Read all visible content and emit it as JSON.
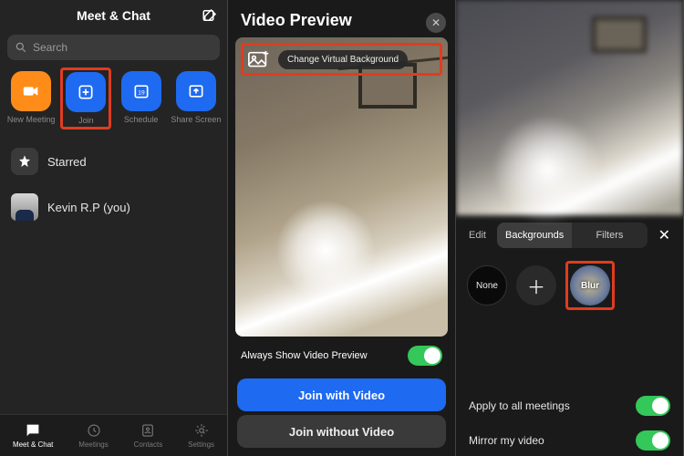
{
  "panel1": {
    "title": "Meet & Chat",
    "search_placeholder": "Search",
    "actions": [
      {
        "label": "New Meeting"
      },
      {
        "label": "Join"
      },
      {
        "label": "Schedule"
      },
      {
        "label": "Share Screen"
      }
    ],
    "starred_label": "Starred",
    "user_name": "Kevin R.P (you)",
    "tabs": [
      {
        "label": "Meet & Chat"
      },
      {
        "label": "Meetings"
      },
      {
        "label": "Contacts"
      },
      {
        "label": "Settings"
      }
    ]
  },
  "panel2": {
    "title": "Video Preview",
    "change_bg_label": "Change Virtual Background",
    "always_show_label": "Always Show Video Preview",
    "join_video_label": "Join with Video",
    "join_no_video_label": "Join without Video"
  },
  "panel3": {
    "edit_label": "Edit",
    "seg_backgrounds": "Backgrounds",
    "seg_filters": "Filters",
    "none_label": "None",
    "blur_label": "Blur",
    "apply_all_label": "Apply to all meetings",
    "mirror_label": "Mirror my video"
  }
}
